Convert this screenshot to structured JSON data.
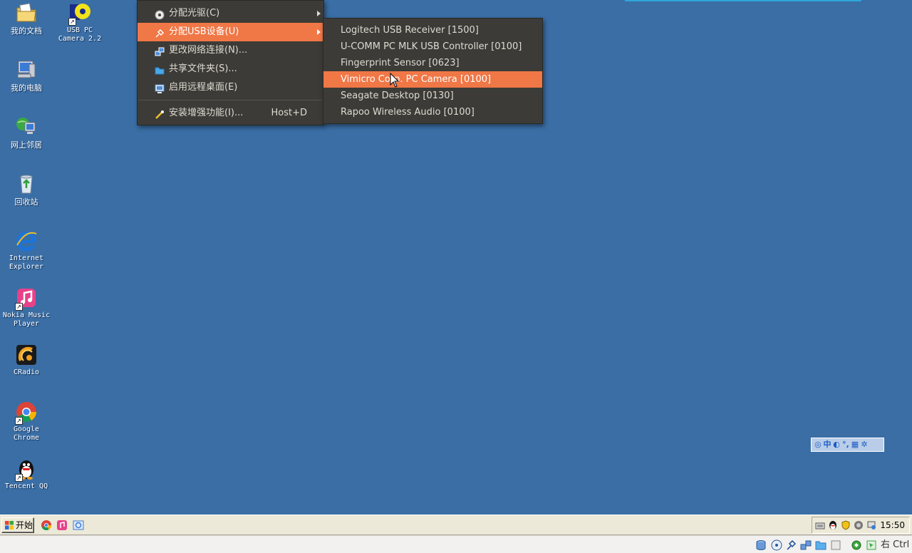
{
  "desktop": {
    "icons": [
      {
        "label": "我的文档"
      },
      {
        "label": "USB PC\nCamera 2.2"
      },
      {
        "label": "我的电脑"
      },
      {
        "label": "网上邻居"
      },
      {
        "label": "回收站"
      },
      {
        "label": "Internet\nExplorer"
      },
      {
        "label": "Nokia Music\nPlayer"
      },
      {
        "label": "CRadio"
      },
      {
        "label": "Google\nChrome"
      },
      {
        "label": "Tencent QQ"
      }
    ]
  },
  "context_menu": {
    "items": [
      {
        "label": "分配光驱(C)",
        "icon": "optical-disc-icon"
      },
      {
        "label": "分配USB设备(U)",
        "icon": "usb-plug-icon"
      },
      {
        "label": "更改网络连接(N)...",
        "icon": "network-icon"
      },
      {
        "label": "共享文件夹(S)...",
        "icon": "folder-icon"
      },
      {
        "label": "启用远程桌面(E)",
        "icon": "remote-desktop-icon"
      },
      {
        "label": "安装增强功能(I)...",
        "icon": "install-wand-icon",
        "shortcut": "Host+D"
      }
    ]
  },
  "usb_submenu": {
    "items": [
      {
        "label": "Logitech USB Receiver [1500]"
      },
      {
        "label": "U-COMM PC MLK USB Controller [0100]"
      },
      {
        "label": "Fingerprint Sensor [0623]"
      },
      {
        "label": "Vimicro Corp. PC Camera [0100]"
      },
      {
        "label": "Seagate Desktop [0130]"
      },
      {
        "label": "Rapoo Wireless Audio [0100]"
      }
    ],
    "selected": "Vimicro Corp. PC Camera [0100]"
  },
  "ime_bar": {
    "mode": "中"
  },
  "taskbar": {
    "start_label": "开始",
    "clock": "15:50"
  },
  "vbox_status": {
    "host_key": "右 Ctrl"
  },
  "colors": {
    "desktop_bg": "#3a6ea5",
    "menu_bg": "#3c3b37",
    "menu_highlight": "#f07746",
    "taskbar_bg": "#ece9d8"
  }
}
